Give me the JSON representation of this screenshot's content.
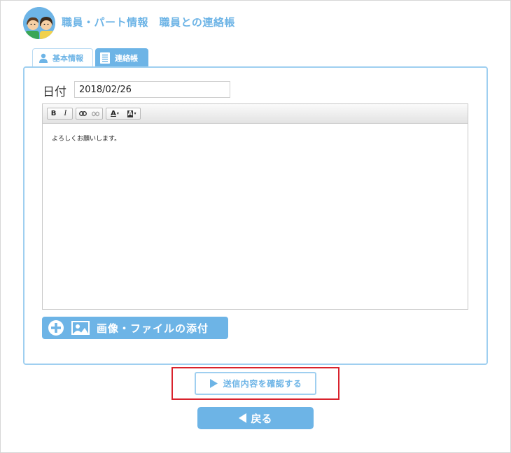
{
  "header": {
    "title": "職員・パート情報　職員との連絡帳"
  },
  "tabs": [
    {
      "label": "基本情報",
      "icon": "user-icon",
      "active": false
    },
    {
      "label": "連絡帳",
      "icon": "notebook-icon",
      "active": true
    }
  ],
  "form": {
    "date_label": "日付",
    "date_value": "2018/02/26"
  },
  "editor": {
    "toolbar": {
      "bold": "B",
      "italic": "I",
      "text_color": "A",
      "bg_color": "A"
    },
    "content": "よろしくお願いします。"
  },
  "attach": {
    "label": "画像・ファイルの添付"
  },
  "confirm": {
    "label": "送信内容を確認する"
  },
  "back": {
    "label": "戻る"
  },
  "colors": {
    "accent": "#6db4e6",
    "accent_light": "#9fcff0",
    "highlight": "#d9232d"
  }
}
